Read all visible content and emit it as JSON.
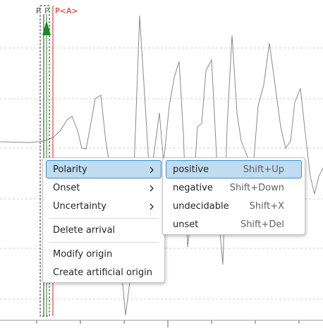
{
  "picks": [
    {
      "label": "P",
      "color": "#444444"
    },
    {
      "label": "P",
      "color": "#2a8a2a"
    },
    {
      "label": "P<A>",
      "color": "#d42020"
    }
  ],
  "context_menu": {
    "items": [
      {
        "label": "Polarity",
        "submenu": true
      },
      {
        "label": "Onset",
        "submenu": true
      },
      {
        "label": "Uncertainty",
        "submenu": true
      },
      {
        "label": "Delete arrival"
      },
      {
        "label": "Modify origin"
      },
      {
        "label": "Create artificial origin"
      }
    ]
  },
  "polarity_submenu": {
    "items": [
      {
        "label": "positive",
        "shortcut": "Shift+Up"
      },
      {
        "label": "negative",
        "shortcut": "Shift+Down"
      },
      {
        "label": "undecidable",
        "shortcut": "Shift+X"
      },
      {
        "label": "unset",
        "shortcut": "Shift+Del"
      }
    ]
  },
  "colors": {
    "trace": "#8a8a8a",
    "grid": "#d0d0d0",
    "pick_marker_green": "#1e8a1e",
    "pick_line_red": "#d42020",
    "highlight": "#bfdcf0",
    "highlight_border": "#3b8fd6"
  }
}
